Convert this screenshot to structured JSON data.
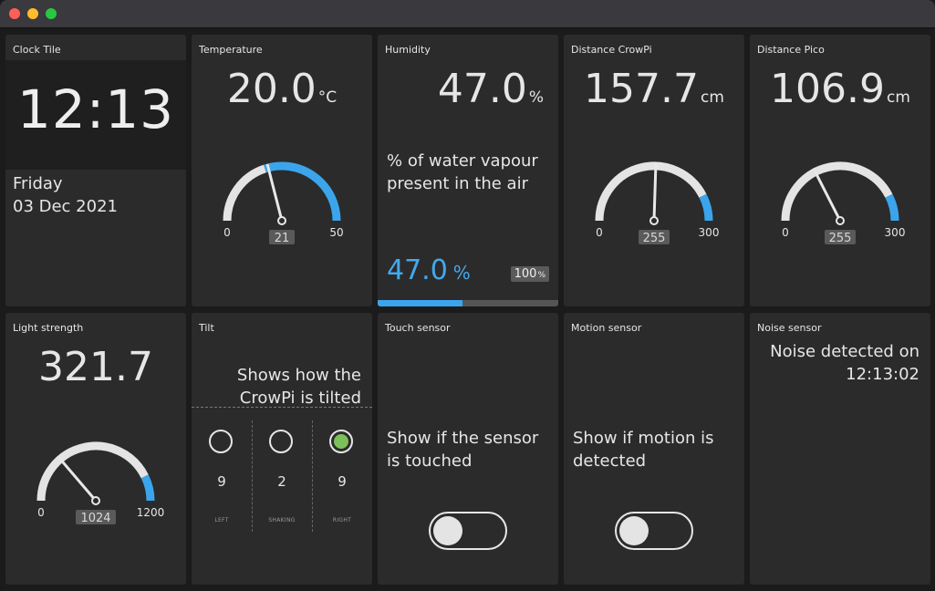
{
  "window": {
    "controls": [
      "close",
      "minimize",
      "zoom"
    ]
  },
  "clock": {
    "title": "Clock Tile",
    "time": "12:13",
    "day": "Friday",
    "date": "03 Dec 2021"
  },
  "temperature": {
    "title": "Temperature",
    "value": "20.0",
    "unit": "°C",
    "gauge": {
      "min": "0",
      "max": "50",
      "needle": "21",
      "value": 21,
      "range": [
        0,
        50
      ],
      "threshold": 20
    }
  },
  "humidity": {
    "title": "Humidity",
    "value": "47.0",
    "unit": "%",
    "description": "% of water vapour present in the air",
    "bar_value": "47.0",
    "bar_unit": "%",
    "max_value": "100",
    "max_unit": "%",
    "fill_fraction": 0.47
  },
  "distance_crowpi": {
    "title": "Distance CrowPi",
    "value": "157.7",
    "unit": "cm",
    "gauge": {
      "min": "0",
      "max": "300",
      "needle": "255",
      "value": 153,
      "range": [
        0,
        300
      ],
      "threshold": 255
    }
  },
  "distance_pico": {
    "title": "Distance Pico",
    "value": "106.9",
    "unit": "cm",
    "gauge": {
      "min": "0",
      "max": "300",
      "needle": "255",
      "value": 105,
      "range": [
        0,
        300
      ],
      "threshold": 255
    }
  },
  "light": {
    "title": "Light strength",
    "value": "321.7",
    "gauge": {
      "min": "0",
      "max": "1200",
      "needle": "1024",
      "value": 330,
      "range": [
        0,
        1200
      ],
      "threshold": 1024
    }
  },
  "tilt": {
    "title": "Tilt",
    "description_line1": "Shows how the",
    "description_line2": "CrowPi is tilted",
    "columns": [
      {
        "count": "9",
        "label": "LEFT",
        "active": false
      },
      {
        "count": "2",
        "label": "SHAKING",
        "active": false
      },
      {
        "count": "9",
        "label": "RIGHT",
        "active": true
      }
    ]
  },
  "touch": {
    "title": "Touch sensor",
    "description": "Show if the sensor is touched",
    "state": "off"
  },
  "motion": {
    "title": "Motion sensor",
    "description": "Show if motion is detected",
    "state": "off"
  },
  "noise": {
    "title": "Noise sensor",
    "line1": "Noise detected on",
    "line2": "12:13:02"
  },
  "colors": {
    "accent": "#3ba5ec",
    "tile_bg": "#2b2b2b",
    "gauge_track": "#e4e4e4",
    "tilt_active": "#7cc05a"
  }
}
